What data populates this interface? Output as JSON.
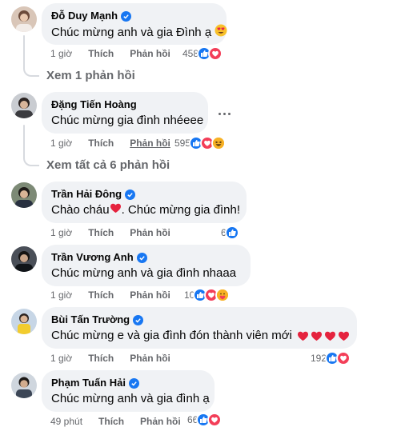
{
  "actions": {
    "like": "Thích",
    "reply": "Phản hồi"
  },
  "comments": [
    {
      "name": "Đỗ Duy Mạnh",
      "verified": true,
      "text": "Chúc mừng anh và gia Đình ạ",
      "emoji": "heart-eyes",
      "time": "1 giờ",
      "reaction_count": "458",
      "reactions": [
        "like",
        "love"
      ]
    },
    {
      "name": "Đặng Tiến Hoàng",
      "verified": false,
      "text": "Chúc mừng gia đình nhéeee",
      "time": "1 giờ",
      "reaction_count": "595",
      "reactions": [
        "like",
        "love",
        "haha"
      ]
    },
    {
      "name": "Trần Hải Đông",
      "verified": true,
      "text_before": "Chào cháu",
      "text_after": ". Chúc mừng gia đình!",
      "time": "1 giờ",
      "reaction_count": "6",
      "reactions": [
        "like"
      ]
    },
    {
      "name": "Trần Vương Anh",
      "verified": true,
      "text": "Chúc mừng anh và gia đình nhaaa",
      "time": "1 giờ",
      "reaction_count": "10",
      "reactions": [
        "like",
        "love",
        "care"
      ]
    },
    {
      "name": "Bùi Tấn Trường",
      "verified": true,
      "text": "Chúc mừng e và gia đình đón thành viên mới",
      "time": "1 giờ",
      "reaction_count": "192",
      "reactions": [
        "like",
        "love"
      ]
    },
    {
      "name": "Phạm Tuấn Hải",
      "verified": true,
      "text": "Chúc mừng anh và gia đình ạ",
      "time": "49 phút",
      "reaction_count": "66",
      "reactions": [
        "like",
        "love"
      ]
    }
  ],
  "view_replies": [
    "Xem 1 phản hồi",
    "Xem tất cả 6 phản hồi"
  ],
  "colors": {
    "accent": "#1877f2",
    "bubble": "#f0f2f5",
    "meta": "#65676b",
    "love": "#f33e58"
  },
  "icons": [
    "verified-badge-icon",
    "like-reaction-icon",
    "love-reaction-icon",
    "haha-reaction-icon",
    "care-reaction-icon",
    "more-options-icon",
    "heart-eyes-emoji",
    "red-heart-emoji"
  ]
}
